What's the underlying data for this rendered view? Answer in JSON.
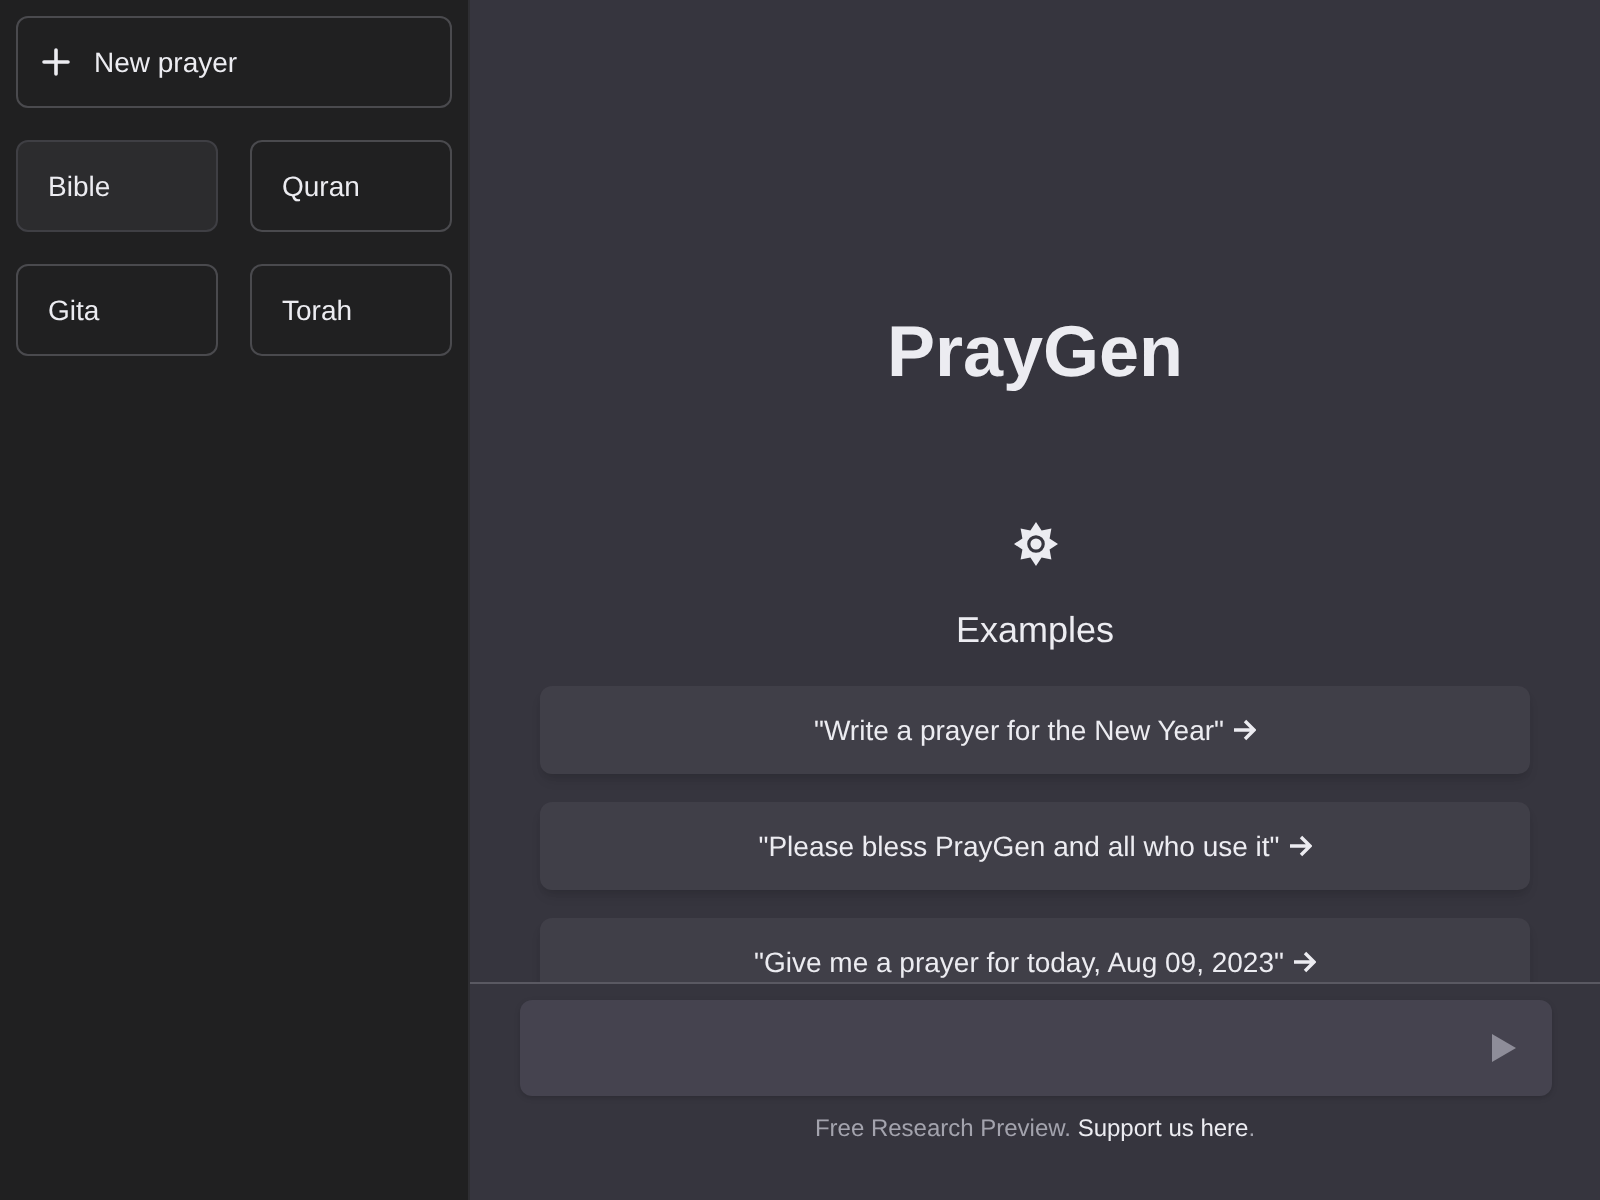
{
  "sidebar": {
    "new_button": {
      "label": "New prayer"
    },
    "scriptures": [
      {
        "label": "Bible",
        "selected": true
      },
      {
        "label": "Quran",
        "selected": false
      },
      {
        "label": "Gita",
        "selected": false
      },
      {
        "label": "Torah",
        "selected": false
      }
    ]
  },
  "main": {
    "title": "PrayGen",
    "examples_heading": "Examples",
    "examples": [
      "\"Write a prayer for the New Year\"",
      "\"Please bless PrayGen and all who use it\"",
      "\"Give me a prayer for today, Aug 09, 2023\""
    ]
  },
  "footer": {
    "text": "Free Research Preview.",
    "link": "Support us here",
    "end": "."
  }
}
